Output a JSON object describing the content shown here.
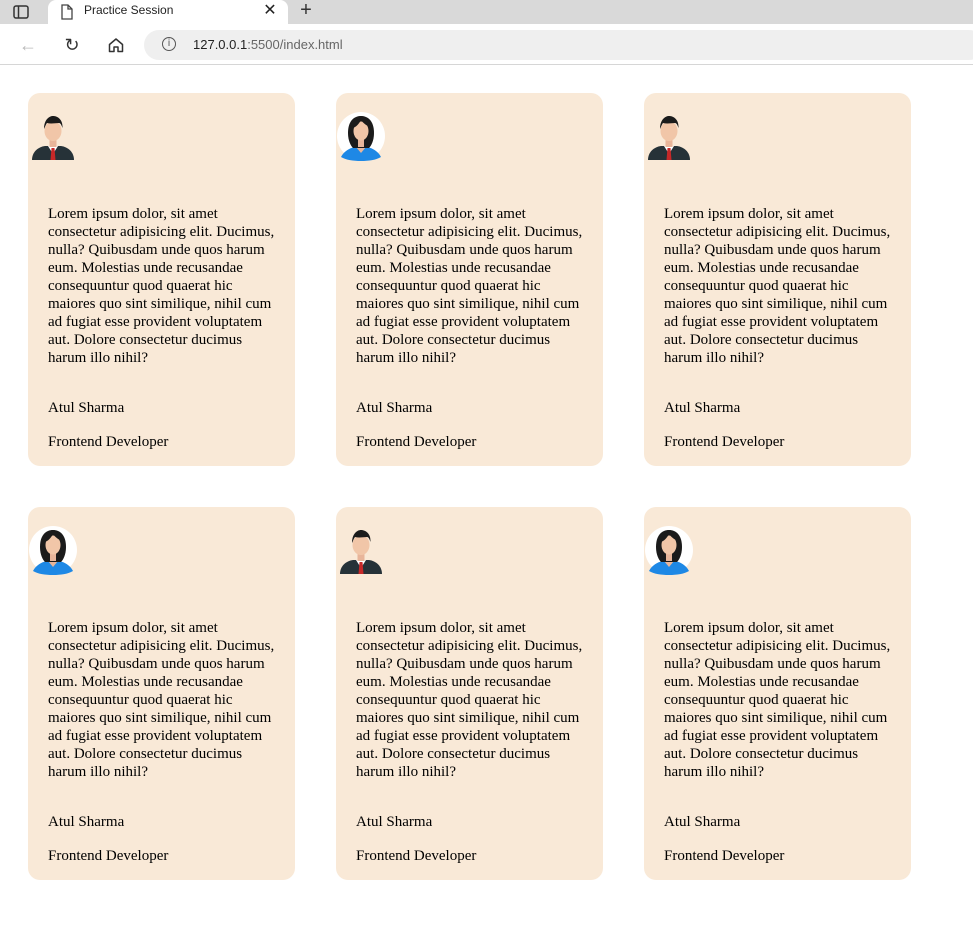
{
  "browser": {
    "tab_title": "Practice Session",
    "close_glyph": "✕",
    "new_tab_glyph": "+",
    "back_glyph": "←",
    "reload_glyph": "↻",
    "info_glyph": "i",
    "url_host": "127.0.0.1",
    "url_rest": ":5500/index.html"
  },
  "cards": [
    {
      "avatar": "male-avatar-icon",
      "text": "Lorem ipsum dolor, sit amet consectetur adipisicing elit. Ducimus, nulla? Quibusdam unde quos harum eum. Molestias unde recusandae consequuntur quod quaerat hic maiores quo sint similique, nihil cum ad fugiat esse provident voluptatem aut. Dolore consectetur ducimus harum illo nihil?",
      "name": "Atul Sharma",
      "role": "Frontend Developer"
    },
    {
      "avatar": "female-avatar-icon",
      "text": "Lorem ipsum dolor, sit amet consectetur adipisicing elit. Ducimus, nulla? Quibusdam unde quos harum eum. Molestias unde recusandae consequuntur quod quaerat hic maiores quo sint similique, nihil cum ad fugiat esse provident voluptatem aut. Dolore consectetur ducimus harum illo nihil?",
      "name": "Atul Sharma",
      "role": "Frontend Developer"
    },
    {
      "avatar": "male-avatar-icon",
      "text": "Lorem ipsum dolor, sit amet consectetur adipisicing elit. Ducimus, nulla? Quibusdam unde quos harum eum. Molestias unde recusandae consequuntur quod quaerat hic maiores quo sint similique, nihil cum ad fugiat esse provident voluptatem aut. Dolore consectetur ducimus harum illo nihil?",
      "name": "Atul Sharma",
      "role": "Frontend Developer"
    },
    {
      "avatar": "female-avatar-icon",
      "text": "Lorem ipsum dolor, sit amet consectetur adipisicing elit. Ducimus, nulla? Quibusdam unde quos harum eum. Molestias unde recusandae consequuntur quod quaerat hic maiores quo sint similique, nihil cum ad fugiat esse provident voluptatem aut. Dolore consectetur ducimus harum illo nihil?",
      "name": "Atul Sharma",
      "role": "Frontend Developer"
    },
    {
      "avatar": "male-avatar-icon",
      "text": "Lorem ipsum dolor, sit amet consectetur adipisicing elit. Ducimus, nulla? Quibusdam unde quos harum eum. Molestias unde recusandae consequuntur quod quaerat hic maiores quo sint similique, nihil cum ad fugiat esse provident voluptatem aut. Dolore consectetur ducimus harum illo nihil?",
      "name": "Atul Sharma",
      "role": "Frontend Developer"
    },
    {
      "avatar": "female-avatar-icon",
      "text": "Lorem ipsum dolor, sit amet consectetur adipisicing elit. Ducimus, nulla? Quibusdam unde quos harum eum. Molestias unde recusandae consequuntur quod quaerat hic maiores quo sint similique, nihil cum ad fugiat esse provident voluptatem aut. Dolore consectetur ducimus harum illo nihil?",
      "name": "Atul Sharma",
      "role": "Frontend Developer"
    }
  ]
}
